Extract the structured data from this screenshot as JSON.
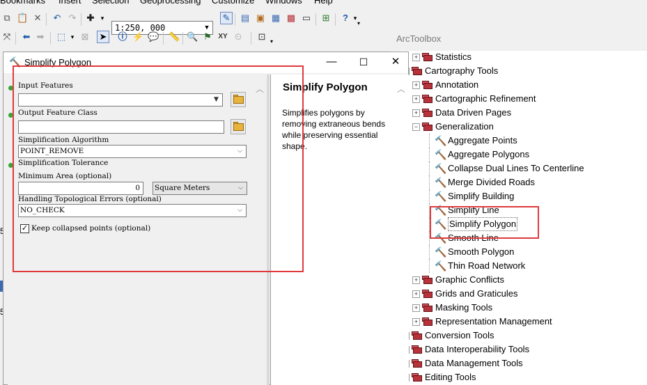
{
  "menubar": {
    "items": [
      "Bookmarks",
      "Insert",
      "Selection",
      "Geoprocessing",
      "Customize",
      "Windows",
      "Help"
    ]
  },
  "toolbar": {
    "scale_value": "1:250, 000"
  },
  "dialog": {
    "title": "Simplify Polygon",
    "params": {
      "input_features_label": "Input Features",
      "input_features_value": "",
      "output_fc_label": "Output Feature Class",
      "output_fc_value": "",
      "algorithm_label": "Simplification Algorithm",
      "algorithm_value": "POINT_REMOVE",
      "tolerance_label": "Simplification Tolerance",
      "min_area_label": "Minimum Area (optional)",
      "min_area_value": "0",
      "min_area_unit": "Square Meters",
      "topo_label": "Handling Topological Errors (optional)",
      "topo_value": "NO_CHECK",
      "keep_collapsed_label": "Keep collapsed points (optional)",
      "keep_collapsed_checked": true
    },
    "help": {
      "title": "Simplify Polygon",
      "body": "Simplifies polygons by removing extraneous bends while preserving essential shape."
    }
  },
  "toolbox": {
    "title": "ArcToolbox",
    "items": [
      {
        "label": "Statistics",
        "level": 2,
        "kind": "toolset",
        "expanded": false
      },
      {
        "label": "Cartography Tools",
        "level": 1,
        "kind": "toolbox",
        "expanded": true
      },
      {
        "label": "Annotation",
        "level": 2,
        "kind": "toolset",
        "expanded": false
      },
      {
        "label": "Cartographic Refinement",
        "level": 2,
        "kind": "toolset",
        "expanded": false
      },
      {
        "label": "Data Driven Pages",
        "level": 2,
        "kind": "toolset",
        "expanded": false
      },
      {
        "label": "Generalization",
        "level": 2,
        "kind": "toolset",
        "expanded": true
      },
      {
        "label": "Aggregate Points",
        "level": 3,
        "kind": "tool"
      },
      {
        "label": "Aggregate Polygons",
        "level": 3,
        "kind": "tool"
      },
      {
        "label": "Collapse Dual Lines To Centerline",
        "level": 3,
        "kind": "tool"
      },
      {
        "label": "Merge Divided Roads",
        "level": 3,
        "kind": "tool"
      },
      {
        "label": "Simplify Building",
        "level": 3,
        "kind": "tool"
      },
      {
        "label": "Simplify Line",
        "level": 3,
        "kind": "tool"
      },
      {
        "label": "Simplify Polygon",
        "level": 3,
        "kind": "tool",
        "selected": true
      },
      {
        "label": "Smooth Line",
        "level": 3,
        "kind": "tool"
      },
      {
        "label": "Smooth Polygon",
        "level": 3,
        "kind": "tool"
      },
      {
        "label": "Thin Road Network",
        "level": 3,
        "kind": "tool"
      },
      {
        "label": "Graphic Conflicts",
        "level": 2,
        "kind": "toolset",
        "expanded": false
      },
      {
        "label": "Grids and Graticules",
        "level": 2,
        "kind": "toolset",
        "expanded": false
      },
      {
        "label": "Masking Tools",
        "level": 2,
        "kind": "toolset",
        "expanded": false
      },
      {
        "label": "Representation Management",
        "level": 2,
        "kind": "toolset",
        "expanded": false
      },
      {
        "label": "Conversion Tools",
        "level": 1,
        "kind": "toolbox",
        "expanded": false
      },
      {
        "label": "Data Interoperability Tools",
        "level": 1,
        "kind": "toolbox",
        "expanded": false
      },
      {
        "label": "Data Management Tools",
        "level": 1,
        "kind": "toolbox",
        "expanded": false
      },
      {
        "label": "Editing Tools",
        "level": 1,
        "kind": "toolbox",
        "expanded": false
      }
    ]
  },
  "colors": {
    "annotation_red": "#e0393c",
    "required_dot": "#39a339",
    "toolbox_red": "#b8323a"
  }
}
